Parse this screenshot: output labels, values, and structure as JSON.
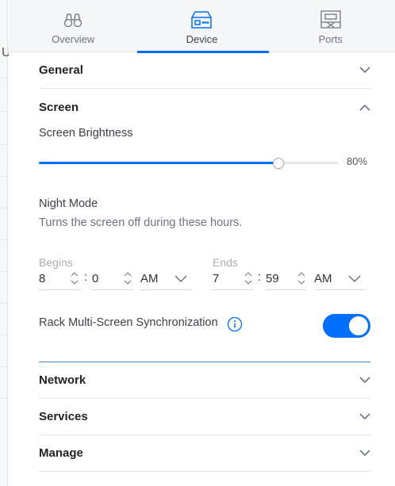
{
  "tabs": [
    {
      "label": "Overview",
      "icon": "binoculars-icon",
      "active": false
    },
    {
      "label": "Device",
      "icon": "device-icon",
      "active": true
    },
    {
      "label": "Ports",
      "icon": "ports-icon",
      "active": false
    }
  ],
  "background": {
    "partial_letter": "U"
  },
  "sections": {
    "general": "General",
    "screen": "Screen",
    "network": "Network",
    "services": "Services",
    "manage": "Manage"
  },
  "screen": {
    "brightness_label": "Screen Brightness",
    "brightness_value": 0.8,
    "brightness_text": "80%",
    "night_mode_title": "Night Mode",
    "night_mode_desc": "Turns the screen off during these hours.",
    "begins": {
      "label": "Begins",
      "hour": "8",
      "minute": "0",
      "ampm": "AM"
    },
    "ends": {
      "label": "Ends",
      "hour": "7",
      "minute": "59",
      "ampm": "AM"
    },
    "separator": ":",
    "rack_sync_label": "Rack Multi-Screen Synchronization",
    "rack_sync_enabled": true
  },
  "colors": {
    "accent": "#006fff",
    "text": "#212327",
    "muted": "#6d737c"
  }
}
